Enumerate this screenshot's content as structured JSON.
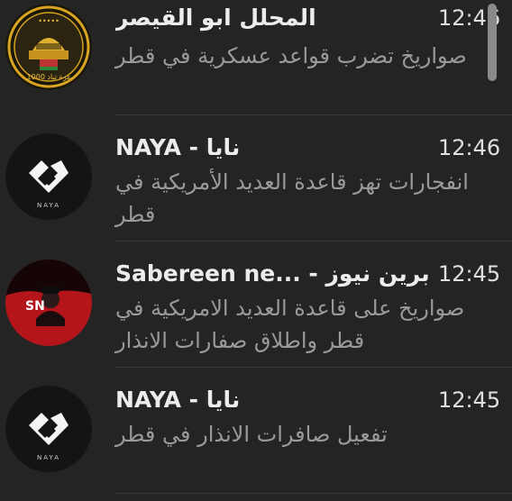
{
  "notifications": [
    {
      "sender": "المحلل ابو القيصر",
      "time": "12:46",
      "message": "صواريخ تضرب قواعد عسكرية في قطر",
      "avatar_icon": "gaza-dome-badge-avatar",
      "avatar_badge_text": "1000 غزة تباد"
    },
    {
      "sender": "NAYA - نايا",
      "time": "12:46",
      "message": "انفجارات تهز قاعدة العديد الأمريكية في قطر",
      "avatar_icon": "naya-logo-avatar",
      "avatar_caption": "NAYA"
    },
    {
      "sender": "Sabereen ne... - صابرين نيوز",
      "time": "12:45",
      "message": "صواريخ على قاعدة العديد الامريكية في قطر واطلاق صفارات الانذار",
      "avatar_icon": "sabereen-news-avatar",
      "avatar_badge_text": "SN"
    },
    {
      "sender": "NAYA - نايا",
      "time": "12:45",
      "message": "تفعيل صافرات الانذار في قطر",
      "avatar_icon": "naya-logo-avatar",
      "avatar_caption": "NAYA"
    }
  ],
  "colors": {
    "background": "#242424",
    "title": "#ececec",
    "body": "#9a9a9a",
    "divider": "#3a3a3a",
    "sabereen_red": "#b3151b",
    "badge_gold": "#d9a520"
  }
}
